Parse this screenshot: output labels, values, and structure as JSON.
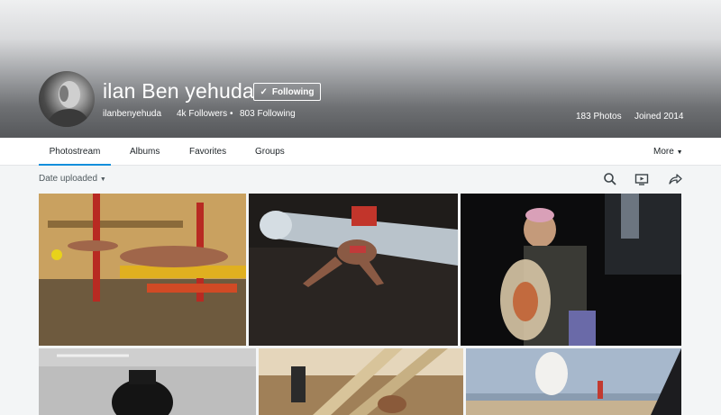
{
  "profile": {
    "name": "ilan Ben yehuda",
    "follow_button": "Following",
    "username": "ilanbenyehuda",
    "followers": "4k Followers",
    "following": "803 Following",
    "photos_count": "183 Photos",
    "joined": "Joined 2014"
  },
  "tabs": [
    {
      "label": "Photostream",
      "active": true
    },
    {
      "label": "Albums"
    },
    {
      "label": "Favorites"
    },
    {
      "label": "Groups"
    }
  ],
  "more_label": "More",
  "toolbar": {
    "sort_label": "Date uploaded",
    "icons": [
      "search-icon",
      "slideshow-icon",
      "share-icon"
    ]
  },
  "colors": {
    "accent": "#128fdc",
    "background": "#f3f5f6"
  }
}
